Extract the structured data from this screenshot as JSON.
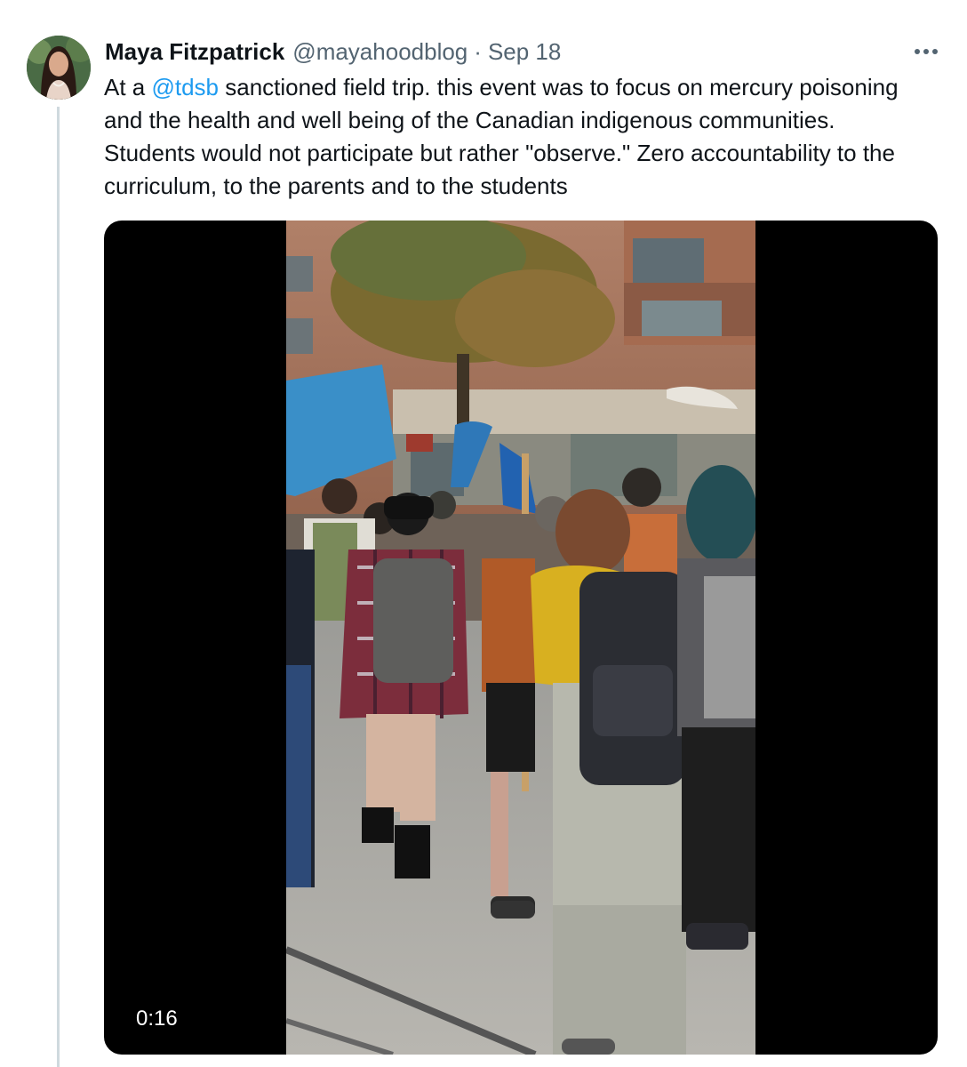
{
  "tweet": {
    "author": {
      "name": "Maya Fitzpatrick",
      "handle": "@mayahoodblog",
      "separator": "·",
      "date": "Sep 18"
    },
    "more_icon": "more-horizontal-icon",
    "text": {
      "before": "At a ",
      "mention": "@tdsb",
      "after": " sanctioned field trip. this event was to focus on mercury poisoning and the health and well being of the Canadian indigenous communities. Students would not participate but rather \"observe.\"  Zero accountability to the curriculum, to the parents and to the students"
    },
    "video": {
      "duration": "0:16"
    },
    "colors": {
      "link": "#1d9bf0",
      "secondary_text": "#536471",
      "primary_text": "#0f1419",
      "thread_line": "#cfd9de"
    }
  }
}
